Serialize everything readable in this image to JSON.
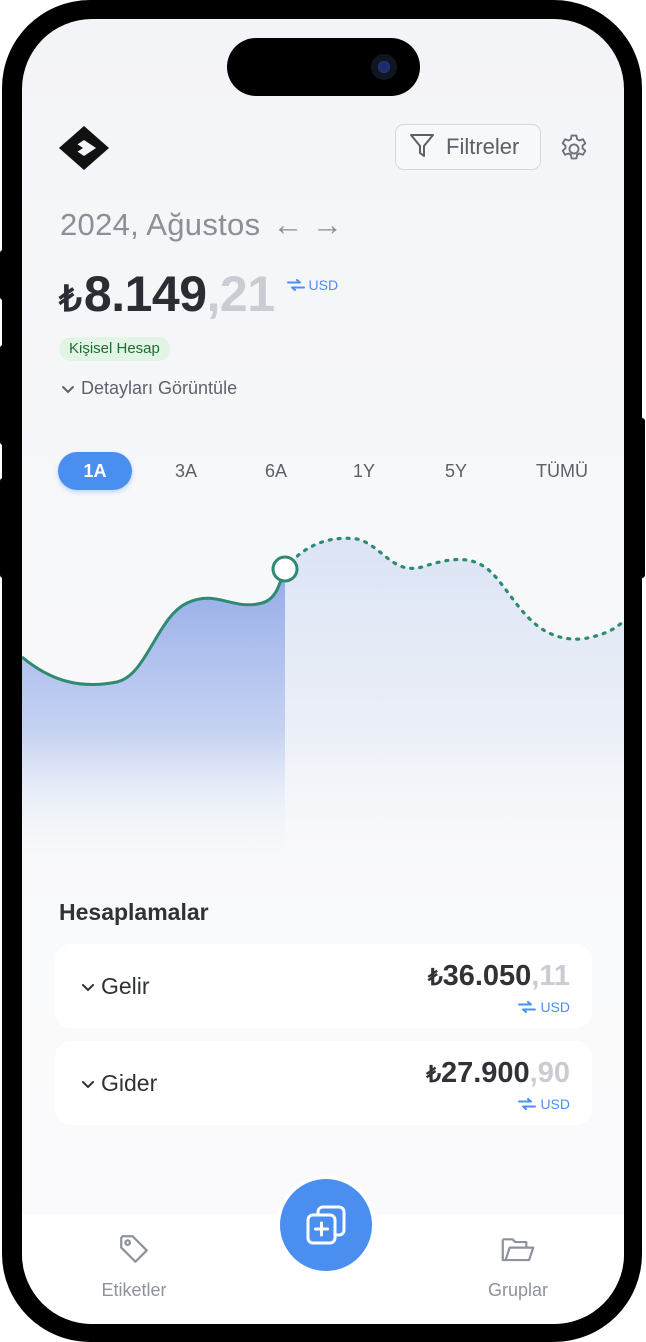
{
  "header": {
    "filter_label": "Filtreler"
  },
  "period": {
    "label": "2024, Ağustos",
    "prev_arrow": "←",
    "next_arrow": "→"
  },
  "balance": {
    "currency_symbol": "₺",
    "integer": "8.149",
    "decimal": ",21",
    "convert_label": "USD"
  },
  "account_badge": "Kişisel Hesap",
  "details_toggle": "Detayları Görüntüle",
  "ranges": [
    {
      "label": "1A",
      "active": true
    },
    {
      "label": "3A",
      "active": false
    },
    {
      "label": "6A",
      "active": false
    },
    {
      "label": "1Y",
      "active": false
    },
    {
      "label": "5Y",
      "active": false
    },
    {
      "label": "TÜMÜ",
      "active": false
    }
  ],
  "colors": {
    "accent": "#4a8ef0",
    "line": "#2e8a70",
    "badge_bg": "#e2f5e5",
    "badge_text": "#1f6b34"
  },
  "calculations": {
    "title": "Hesaplamalar",
    "items": [
      {
        "label": "Gelir",
        "currency_symbol": "₺",
        "integer": "36.050",
        "decimal": ",11",
        "convert_label": "USD"
      },
      {
        "label": "Gider",
        "currency_symbol": "₺",
        "integer": "27.900",
        "decimal": ",90",
        "convert_label": "USD"
      }
    ]
  },
  "tabbar": {
    "left": {
      "label": "Etiketler",
      "icon": "tag-icon"
    },
    "center": {
      "icon": "add-transaction-icon"
    },
    "right": {
      "label": "Gruplar",
      "icon": "folder-icon"
    }
  }
}
